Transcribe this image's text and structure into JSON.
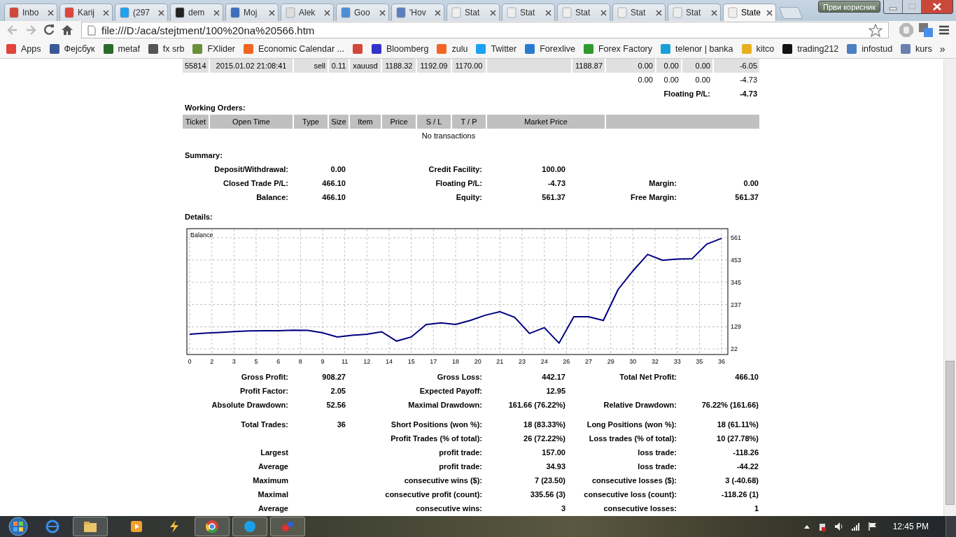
{
  "browser": {
    "tabs": [
      {
        "title": "Inbo",
        "selected": false
      },
      {
        "title": "Karij",
        "selected": false
      },
      {
        "title": "(297",
        "selected": false
      },
      {
        "title": "dem",
        "selected": false
      },
      {
        "title": "Moj",
        "selected": false
      },
      {
        "title": "Alek",
        "selected": false
      },
      {
        "title": "Goo",
        "selected": false
      },
      {
        "title": "'Hov",
        "selected": false
      },
      {
        "title": "Stat",
        "selected": false
      },
      {
        "title": "Stat",
        "selected": false
      },
      {
        "title": "Stat",
        "selected": false
      },
      {
        "title": "Stat",
        "selected": false
      },
      {
        "title": "Stat",
        "selected": false
      },
      {
        "title": "State",
        "selected": true
      }
    ],
    "user": "Први корисник",
    "address": "file:///D:/aca/stejtment/100%20na%20566.htm",
    "bookmarks": [
      {
        "label": "Apps"
      },
      {
        "label": "Фејсбук"
      },
      {
        "label": "metaf"
      },
      {
        "label": "fx srb"
      },
      {
        "label": "FXlider"
      },
      {
        "label": "Economic Calendar ..."
      },
      {
        "kind": "icon"
      },
      {
        "label": "Bloomberg"
      },
      {
        "label": "zulu"
      },
      {
        "label": "Twitter"
      },
      {
        "label": "Forexlive"
      },
      {
        "label": "Forex Factory"
      },
      {
        "label": "telenor | banka"
      },
      {
        "label": "kitco"
      },
      {
        "label": "trading212"
      },
      {
        "label": "infostud"
      },
      {
        "label": "kurs"
      }
    ],
    "more": "»"
  },
  "report": {
    "positions": {
      "rows": [
        [
          "55814",
          "2015.01.02 21:08:41",
          "sell",
          "0.11",
          "xauusd",
          "1188.32",
          "1192.09",
          "1170.00",
          null,
          "1188.87",
          "0.00",
          "0.00",
          "0.00",
          "-6.05"
        ]
      ],
      "totals": [
        "0.00",
        "0.00",
        "0.00",
        "-4.73"
      ],
      "floating": {
        "label": "Floating P/L:",
        "value": "-4.73"
      }
    },
    "working_orders": {
      "title": "Working Orders:",
      "columns": [
        "Ticket",
        "Open Time",
        "Type",
        "Size",
        "Item",
        "Price",
        "S / L",
        "T / P",
        "Market Price"
      ],
      "empty": "No transactions"
    },
    "summary": {
      "title": "Summary:",
      "rows": [
        [
          {
            "label": "Deposit/Withdrawal:",
            "value": "0.00"
          },
          {
            "label": "Credit Facility:",
            "value": "100.00"
          },
          null
        ],
        [
          {
            "label": "Closed Trade P/L:",
            "value": "466.10"
          },
          {
            "label": "Floating P/L:",
            "value": "-4.73"
          },
          {
            "label": "Margin:",
            "value": "0.00"
          }
        ],
        [
          {
            "label": "Balance:",
            "value": "466.10"
          },
          {
            "label": "Equity:",
            "value": "561.37"
          },
          {
            "label": "Free Margin:",
            "value": "561.37"
          }
        ]
      ]
    },
    "details": {
      "title": "Details:",
      "chart_data": {
        "type": "line",
        "title": "Balance",
        "x": [
          0,
          1,
          2,
          3,
          4,
          5,
          6,
          7,
          8,
          9,
          10,
          11,
          12,
          13,
          14,
          15,
          16,
          17,
          18,
          19,
          20,
          21,
          22,
          23,
          24,
          25,
          26,
          27,
          28,
          29,
          30,
          31,
          32,
          33,
          34,
          35,
          36
        ],
        "grid": true,
        "series": [
          {
            "color": "#000080",
            "values": [
              93,
              98,
              102,
              106,
              109,
              110,
              110,
              113,
              112,
              100,
              80,
              88,
              93,
              105,
              60,
              80,
              140,
              148,
              141,
              160,
              185,
              202,
              175,
              97,
              125,
              50,
              178,
              178,
              160,
              310,
              400,
              480,
              452,
              458,
              459,
              530,
              558
            ]
          }
        ],
        "xlim": [
          0,
          36
        ],
        "ylim": [
          22,
          561
        ],
        "xticks": [
          {
            "value": 0,
            "label": "0"
          },
          {
            "value": 1.5,
            "label": "2"
          },
          {
            "value": 3,
            "label": "3"
          },
          {
            "value": 4.5,
            "label": "5"
          },
          {
            "value": 6,
            "label": "6"
          },
          {
            "value": 7.5,
            "label": "8"
          },
          {
            "value": 9,
            "label": "9"
          },
          {
            "value": 10.5,
            "label": "11"
          },
          {
            "value": 12,
            "label": "12"
          },
          {
            "value": 13.5,
            "label": "14"
          },
          {
            "value": 15,
            "label": "15"
          },
          {
            "value": 16.5,
            "label": "17"
          },
          {
            "value": 18,
            "label": "18"
          },
          {
            "value": 19.5,
            "label": "20"
          },
          {
            "value": 21,
            "label": "21"
          },
          {
            "value": 22.5,
            "label": "23"
          },
          {
            "value": 24,
            "label": "24"
          },
          {
            "value": 25.5,
            "label": "26"
          },
          {
            "value": 27,
            "label": "27"
          },
          {
            "value": 28.5,
            "label": "29"
          },
          {
            "value": 30,
            "label": "30"
          },
          {
            "value": 31.5,
            "label": "32"
          },
          {
            "value": 33,
            "label": "33"
          },
          {
            "value": 34.5,
            "label": "35"
          },
          {
            "value": 36,
            "label": "36"
          }
        ],
        "yticks": [
          22,
          129,
          237,
          345,
          453,
          561
        ]
      }
    },
    "stats_groups": [
      {
        "rows": [
          [
            {
              "label": "Gross Profit:",
              "value": "908.27"
            },
            {
              "label": "Gross Loss:",
              "value": "442.17"
            },
            {
              "label": "Total Net Profit:",
              "value": "466.10"
            }
          ],
          [
            {
              "label": "Profit Factor:",
              "value": "2.05"
            },
            {
              "label": "Expected Payoff:",
              "value": "12.95"
            },
            null
          ],
          [
            {
              "label": "Absolute Drawdown:",
              "value": "52.56"
            },
            {
              "label": "Maximal Drawdown:",
              "value": "161.66 (76.22%)"
            },
            {
              "label": "Relative Drawdown:",
              "value": "76.22% (161.66)"
            }
          ]
        ]
      },
      {
        "rows": [
          [
            {
              "label": "Total Trades:",
              "value": "36"
            },
            {
              "label": "Short Positions (won %):",
              "value": "18 (83.33%)"
            },
            {
              "label": "Long Positions (won %):",
              "value": "18 (61.11%)"
            }
          ],
          [
            null,
            {
              "label": "Profit Trades (% of total):",
              "value": "26 (72.22%)"
            },
            {
              "label": "Loss trades (% of total):",
              "value": "10 (27.78%)"
            }
          ],
          [
            {
              "label": "Largest"
            },
            {
              "label": "profit trade:",
              "value": "157.00"
            },
            {
              "label": "loss trade:",
              "value": "-118.26"
            }
          ],
          [
            {
              "label": "Average"
            },
            {
              "label": "profit trade:",
              "value": "34.93"
            },
            {
              "label": "loss trade:",
              "value": "-44.22"
            }
          ],
          [
            {
              "label": "Maximum"
            },
            {
              "label": "consecutive wins ($):",
              "value": "7 (23.50)"
            },
            {
              "label": "consecutive losses ($):",
              "value": "3 (-40.68)"
            }
          ],
          [
            {
              "label": "Maximal"
            },
            {
              "label": "consecutive profit (count):",
              "value": "335.56 (3)"
            },
            {
              "label": "consecutive loss (count):",
              "value": "-118.26 (1)"
            }
          ],
          [
            {
              "label": "Average"
            },
            {
              "label": "consecutive wins:",
              "value": "3"
            },
            {
              "label": "consecutive losses:",
              "value": "1"
            }
          ]
        ]
      }
    ]
  },
  "taskbar": {
    "clock": "12:45 PM"
  }
}
